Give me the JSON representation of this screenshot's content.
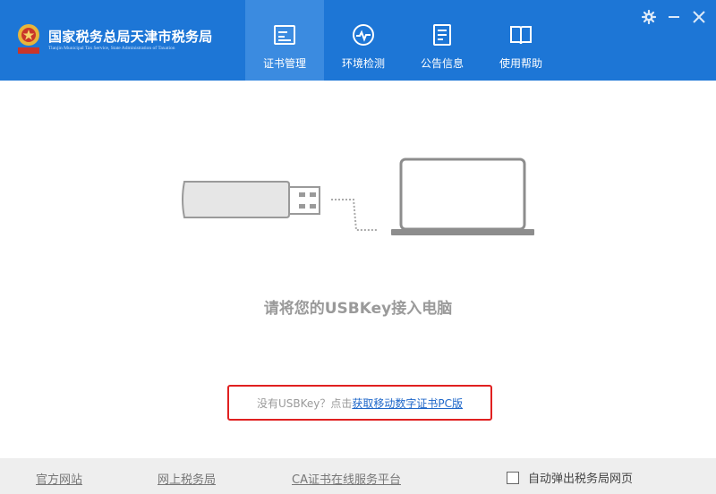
{
  "header": {
    "brand_cn": "国家税务总局天津市税务局",
    "brand_en": "Tianjin Municipal Tax Service, State Administration of Taxation",
    "colors": {
      "bar": "#1d76d6",
      "active_tab": "#3b8be0"
    },
    "tabs": [
      {
        "label": "证书管理",
        "icon": "certificate-icon",
        "active": true
      },
      {
        "label": "环境检测",
        "icon": "gauge-icon",
        "active": false
      },
      {
        "label": "公告信息",
        "icon": "document-icon",
        "active": false
      },
      {
        "label": "使用帮助",
        "icon": "book-icon",
        "active": false
      }
    ],
    "window_controls": [
      "settings-icon",
      "minimize-icon",
      "close-icon"
    ]
  },
  "main": {
    "prompt": "请将您的USBKey接入电脑",
    "link_static": "没有USBKey？点击",
    "link_action": "获取移动数字证书PC版",
    "highlight_color": "#e02020"
  },
  "footer": {
    "links": [
      "官方网站",
      "网上税务局",
      "CA证书在线服务平台"
    ],
    "checkbox_label": "自动弹出税务局网页",
    "checkbox_checked": false
  }
}
